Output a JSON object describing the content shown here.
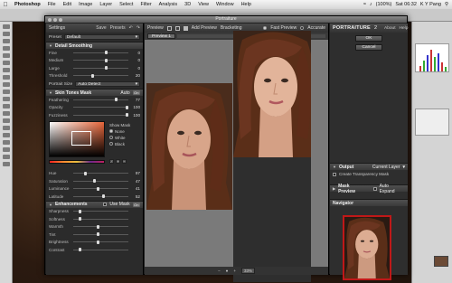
{
  "menubar": {
    "app": "Photoshop",
    "menus": [
      "File",
      "Edit",
      "Image",
      "Layer",
      "Select",
      "Filter",
      "Analysis",
      "3D",
      "View",
      "Window",
      "Help"
    ],
    "clock": "Sat 06:32",
    "user": "K Y Pang",
    "battery": "(100%)"
  },
  "window": {
    "title": "Portraiture"
  },
  "settings": {
    "header": "Settings",
    "save": "Save",
    "presets": "Presets",
    "preset_label": "Preset",
    "preset_value": "Default",
    "detail": {
      "title": "Detail Smoothing",
      "sliders": [
        {
          "label": "Fine",
          "value": "0",
          "pos": 0.6
        },
        {
          "label": "Medium",
          "value": "0",
          "pos": 0.6
        },
        {
          "label": "Large",
          "value": "0",
          "pos": 0.6
        },
        {
          "label": "Threshold",
          "value": "20",
          "pos": 0.35
        }
      ],
      "portrait_size_label": "Portrait Size",
      "portrait_size_value": "Auto Detect"
    },
    "mask": {
      "title": "Skin Tones Mask",
      "mode": "Auto",
      "chip": "On",
      "sliders": [
        {
          "label": "Feathering",
          "value": "77",
          "pos": 0.78
        },
        {
          "label": "Opacity",
          "value": "100",
          "pos": 0.98
        },
        {
          "label": "Fuzziness",
          "value": "100",
          "pos": 0.98
        }
      ],
      "show_mask_label": "Show Mask",
      "show_mask_options": [
        "None",
        "White",
        "Black"
      ],
      "hsl": [
        {
          "label": "Hue",
          "value": "97",
          "pos": 0.22
        },
        {
          "label": "Saturation",
          "value": "47",
          "pos": 0.38
        },
        {
          "label": "Luminance",
          "value": "41",
          "pos": 0.45
        },
        {
          "label": "Latitude",
          "value": "52",
          "pos": 0.55
        }
      ]
    },
    "enhancements": {
      "title": "Enhancements",
      "use_mask": "Use Mask",
      "chip": "On",
      "sliders": [
        {
          "label": "Sharpness",
          "pos": 0.12
        },
        {
          "label": "Softness",
          "pos": 0.12
        },
        {
          "label": "Warmth",
          "pos": 0.45
        },
        {
          "label": "Tint",
          "pos": 0.45
        },
        {
          "label": "Brightness",
          "pos": 0.45
        },
        {
          "label": "Contrast",
          "pos": 0.12
        }
      ]
    }
  },
  "preview": {
    "header": "Preview",
    "add_preview": "Add Preview",
    "bracketing": "Bracketing",
    "fast_preview": "Fast Preview",
    "accurate": "Accurate",
    "tab": "Preview 1",
    "zoom": "33%"
  },
  "right": {
    "brand": "PORTRAITURE",
    "version": "2",
    "about": "About",
    "help": "Help",
    "ok": "OK",
    "cancel": "Cancel",
    "output_title": "Output",
    "output_value": "Current Layer",
    "transparency": "Create Transparency Mask",
    "mask_preview": "Mask Preview",
    "auto_expand": "Auto Expand",
    "navigator": "Navigator"
  },
  "colors": {
    "accent": "#c01818",
    "panel": "#2b2b2b",
    "preview_bg": "#7a7a7a"
  }
}
